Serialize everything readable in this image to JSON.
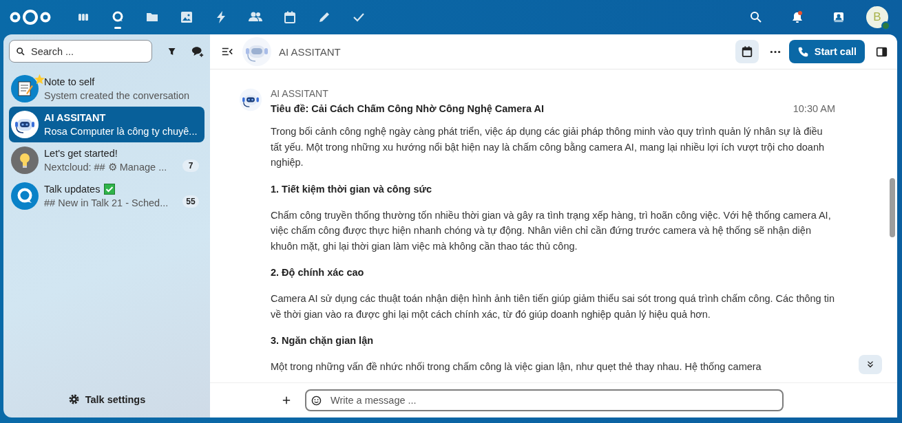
{
  "top_bar": {
    "apps": [
      {
        "kind": "dashboard",
        "selected": false
      },
      {
        "kind": "talk",
        "selected": true
      },
      {
        "kind": "files",
        "selected": false
      },
      {
        "kind": "photos",
        "selected": false
      },
      {
        "kind": "activity",
        "selected": false
      },
      {
        "kind": "contacts",
        "selected": false
      },
      {
        "kind": "calendar",
        "selected": false
      },
      {
        "kind": "notes",
        "selected": false
      },
      {
        "kind": "tasks",
        "selected": false
      }
    ],
    "notifications": {
      "unread": true
    },
    "user": {
      "initial": "B",
      "online": true
    }
  },
  "sidebar": {
    "search": {
      "placeholder": "Search ..."
    },
    "conversations": [
      {
        "kind": "note",
        "name": "Note to self",
        "preview": "System created the conversation",
        "favorite": true,
        "selected": false
      },
      {
        "kind": "bot",
        "name": "AI ASSITANT",
        "preview": "Rosa Computer là công ty chuyê...",
        "favorite": false,
        "selected": true
      },
      {
        "kind": "bulb",
        "name": "Let's get started!",
        "preview": "Nextcloud: ## ⚙ Manage ...",
        "favorite": false,
        "selected": false,
        "unread": "7"
      },
      {
        "kind": "talk",
        "name": "Talk updates",
        "preview": "## New in Talk 21 - Sched...",
        "favorite": false,
        "selected": false,
        "unread": "55"
      }
    ],
    "settings": "Talk settings"
  },
  "chat": {
    "title": "AI ASSITANT",
    "call_button": "Start call",
    "message": {
      "author": "AI ASSITANT",
      "time": "10:30 AM",
      "blocks": [
        {
          "kind": "title",
          "text": "Tiêu đề: Cải Cách Chấm Công Nhờ Công Nghệ Camera AI"
        },
        {
          "kind": "paragraph",
          "text": "Trong bối cảnh công nghệ ngày càng phát triển, việc áp dụng các giải pháp thông minh vào quy trình quản lý nhân sự là điều tất yếu. Một trong những xu hướng nổi bật hiện nay là chấm công bằng camera AI, mang lại nhiều lợi ích vượt trội cho doanh nghiệp."
        },
        {
          "kind": "heading",
          "text": "1. Tiết kiệm thời gian và công sức"
        },
        {
          "kind": "paragraph",
          "text": "Chấm công truyền thống thường tốn nhiều thời gian và gây ra tình trạng xếp hàng, trì hoãn công việc. Với hệ thống camera AI, việc chấm công được thực hiện nhanh chóng và tự động. Nhân viên chỉ cần đứng trước camera và hệ thống sẽ nhận diện khuôn mặt, ghi lại thời gian làm việc mà không cần thao tác thủ công."
        },
        {
          "kind": "heading",
          "text": "2. Độ chính xác cao"
        },
        {
          "kind": "paragraph",
          "text": "Camera AI sử dụng các thuật toán nhận diện hình ảnh tiên tiến giúp giảm thiểu sai sót trong quá trình chấm công. Các thông tin về thời gian vào ra được ghi lại một cách chính xác, từ đó giúp doanh nghiệp quản lý hiệu quả hơn."
        },
        {
          "kind": "heading",
          "text": "3. Ngăn chặn gian lận"
        },
        {
          "kind": "paragraph",
          "text": "Một trong những vấn đề nhức nhối trong chấm công là việc gian lận, như quẹt thẻ thay nhau. Hệ thống camera"
        }
      ]
    },
    "composer": {
      "placeholder": "Write a message ..."
    }
  }
}
